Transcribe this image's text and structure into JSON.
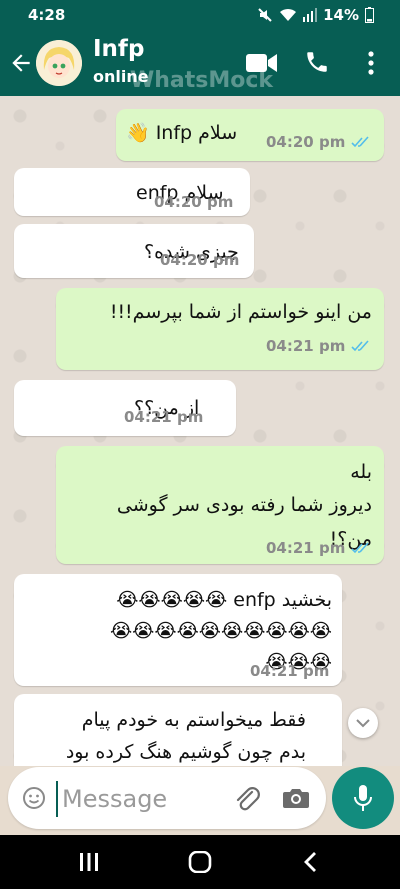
{
  "status_bar": {
    "time": "4:28",
    "battery": "14%"
  },
  "header": {
    "contact_name": "Infp",
    "contact_status": "online",
    "watermark": "WhatsMock"
  },
  "messages": [
    {
      "direction": "out",
      "lines": [
        "سلام Infp 👋"
      ],
      "time": "04:20 pm",
      "read": true
    },
    {
      "direction": "in",
      "lines": [
        "سلام enfp"
      ],
      "time": "04:20 pm"
    },
    {
      "direction": "in",
      "lines": [
        "چیزی شده؟"
      ],
      "time": "04:20 pm"
    },
    {
      "direction": "out",
      "lines": [
        "من اینو خواستم از شما بپرسم!!!"
      ],
      "time": "04:21 pm",
      "read": true
    },
    {
      "direction": "in",
      "lines": [
        "از من؟؟"
      ],
      "time": "04:21 pm"
    },
    {
      "direction": "out",
      "lines": [
        "بله",
        "دیروز شما رفته بودی سر گوشی",
        "من؟!"
      ],
      "time": "04:21 pm",
      "read": true
    },
    {
      "direction": "in",
      "lines": [
        "بخشید enfp 😭😭😭😭😭",
        "😭😭😭😭😭😭😭😭😭😭",
        "😭😭😭"
      ],
      "time": "04:21 pm"
    },
    {
      "direction": "in",
      "lines": [
        "فقط میخواستم به خودم پیام",
        "بدم چون گوشیم هنگ کرده بود"
      ],
      "time": ""
    }
  ],
  "input": {
    "placeholder": "Message"
  },
  "icons": {
    "back": "arrow-left-icon",
    "video": "video-call-icon",
    "call": "phone-icon",
    "menu": "more-vert-icon",
    "emoji": "emoji-icon",
    "attach": "paperclip-icon",
    "camera": "camera-icon",
    "mic": "mic-icon",
    "scroll": "chevron-down-icon"
  },
  "colors": {
    "header": "#075e54",
    "outgoing_bubble": "#dcf8c6",
    "incoming_bubble": "#ffffff",
    "read_ticks": "#53bdeb",
    "mic_button": "#128c7e"
  }
}
